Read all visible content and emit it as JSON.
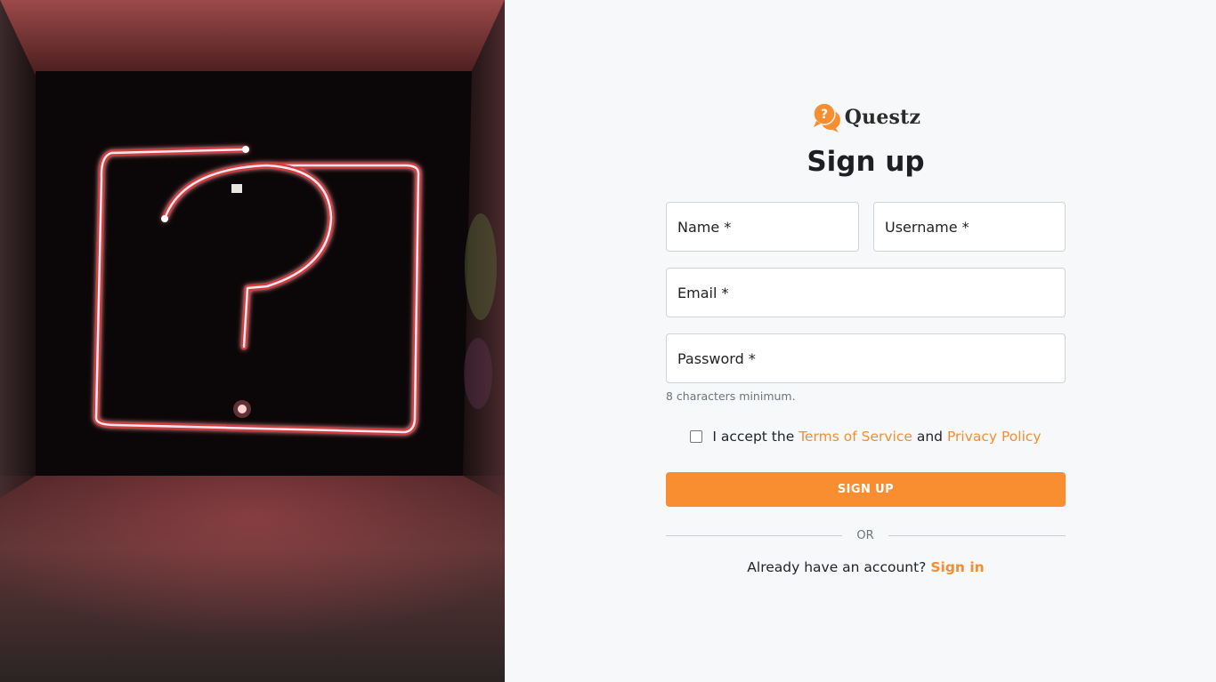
{
  "brand": {
    "name": "Questz",
    "logo_icon": "question-chat-bubbles-icon",
    "accent_color": "#f98e31"
  },
  "hero": {
    "image": "neon-question-mark-photo"
  },
  "form": {
    "title": "Sign up",
    "name_placeholder": "Name *",
    "username_placeholder": "Username *",
    "email_placeholder": "Email *",
    "password_placeholder": "Password *",
    "password_hint": "8 characters minimum.",
    "terms": {
      "prefix": "I accept the",
      "tos_link": "Terms of Service",
      "conjunction": "and",
      "privacy_link": "Privacy Policy",
      "checked": false
    },
    "submit_label": "SIGN UP",
    "divider_label": "OR",
    "signin": {
      "prompt": "Already have an account?",
      "link": "Sign in"
    }
  }
}
